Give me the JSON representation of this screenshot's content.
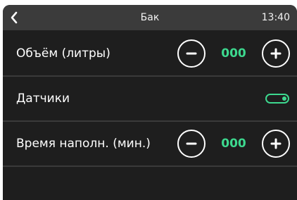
{
  "header": {
    "title": "Бак",
    "clock": "13:40",
    "back_icon": "chevron-left-icon"
  },
  "settings": {
    "volume": {
      "label": "Объём (литры)",
      "value": "000"
    },
    "sensors": {
      "label": "Датчики",
      "enabled": true
    },
    "fill_time": {
      "label": "Время наполн. (мин.)",
      "value": "000"
    }
  },
  "colors": {
    "accent": "#3dd98f",
    "background": "#1e1e1e",
    "header": "#3b3b3b"
  }
}
